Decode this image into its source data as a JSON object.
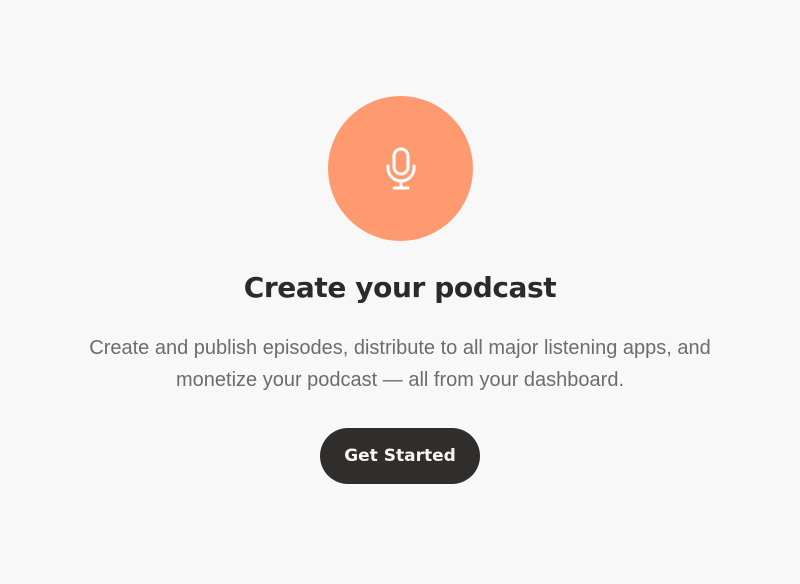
{
  "hero": {
    "icon": "microphone-icon",
    "icon_background_color": "#ff9a70",
    "title": "Create your podcast",
    "description": "Create and publish episodes, distribute to all major listening apps, and monetize your podcast — all from your dashboard."
  },
  "actions": {
    "get_started_label": "Get Started",
    "button_color": "#302e2c"
  }
}
